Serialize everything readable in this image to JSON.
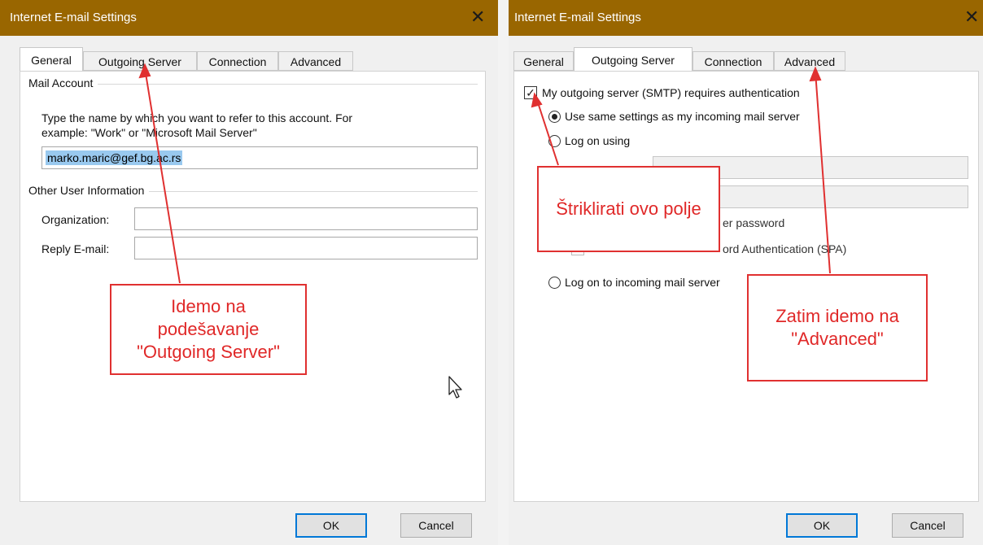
{
  "left": {
    "title": "Internet E-mail Settings",
    "close": "✕",
    "tabs": [
      "General",
      "Outgoing Server",
      "Connection",
      "Advanced"
    ],
    "group_mail": "Mail Account",
    "desc_line1": "Type the name by which you want to refer to this account. For",
    "desc_line2": "example: \"Work\" or \"Microsoft Mail Server\"",
    "account_value": "marko.maric@gef.bg.ac.rs",
    "group_other": "Other User Information",
    "org_label": "Organization:",
    "reply_label": "Reply E-mail:",
    "ok": "OK",
    "cancel": "Cancel"
  },
  "right": {
    "title": "Internet E-mail Settings",
    "close": "✕",
    "tabs": [
      "General",
      "Outgoing Server",
      "Connection",
      "Advanced"
    ],
    "smtp_check": "My outgoing server (SMTP) requires authentication",
    "radio_same": "Use same settings as my incoming mail server",
    "radio_logon": "Log on using",
    "partial_password": "er password",
    "partial_spa": "ord Authentication (SPA)",
    "radio_incoming": "Log on to incoming mail server",
    "ok": "OK",
    "cancel": "Cancel"
  },
  "callouts": {
    "outgoing_1": "Idemo na",
    "outgoing_2": "podešavanje",
    "outgoing_3": "\"Outgoing Server\"",
    "check": "Štriklirati ovo polje",
    "advanced_1": "Zatim idemo na",
    "advanced_2": "\"Advanced\""
  },
  "colors": {
    "titlebar": "#996600",
    "annotation": "#e03030",
    "primary_button": "#0078d7"
  }
}
